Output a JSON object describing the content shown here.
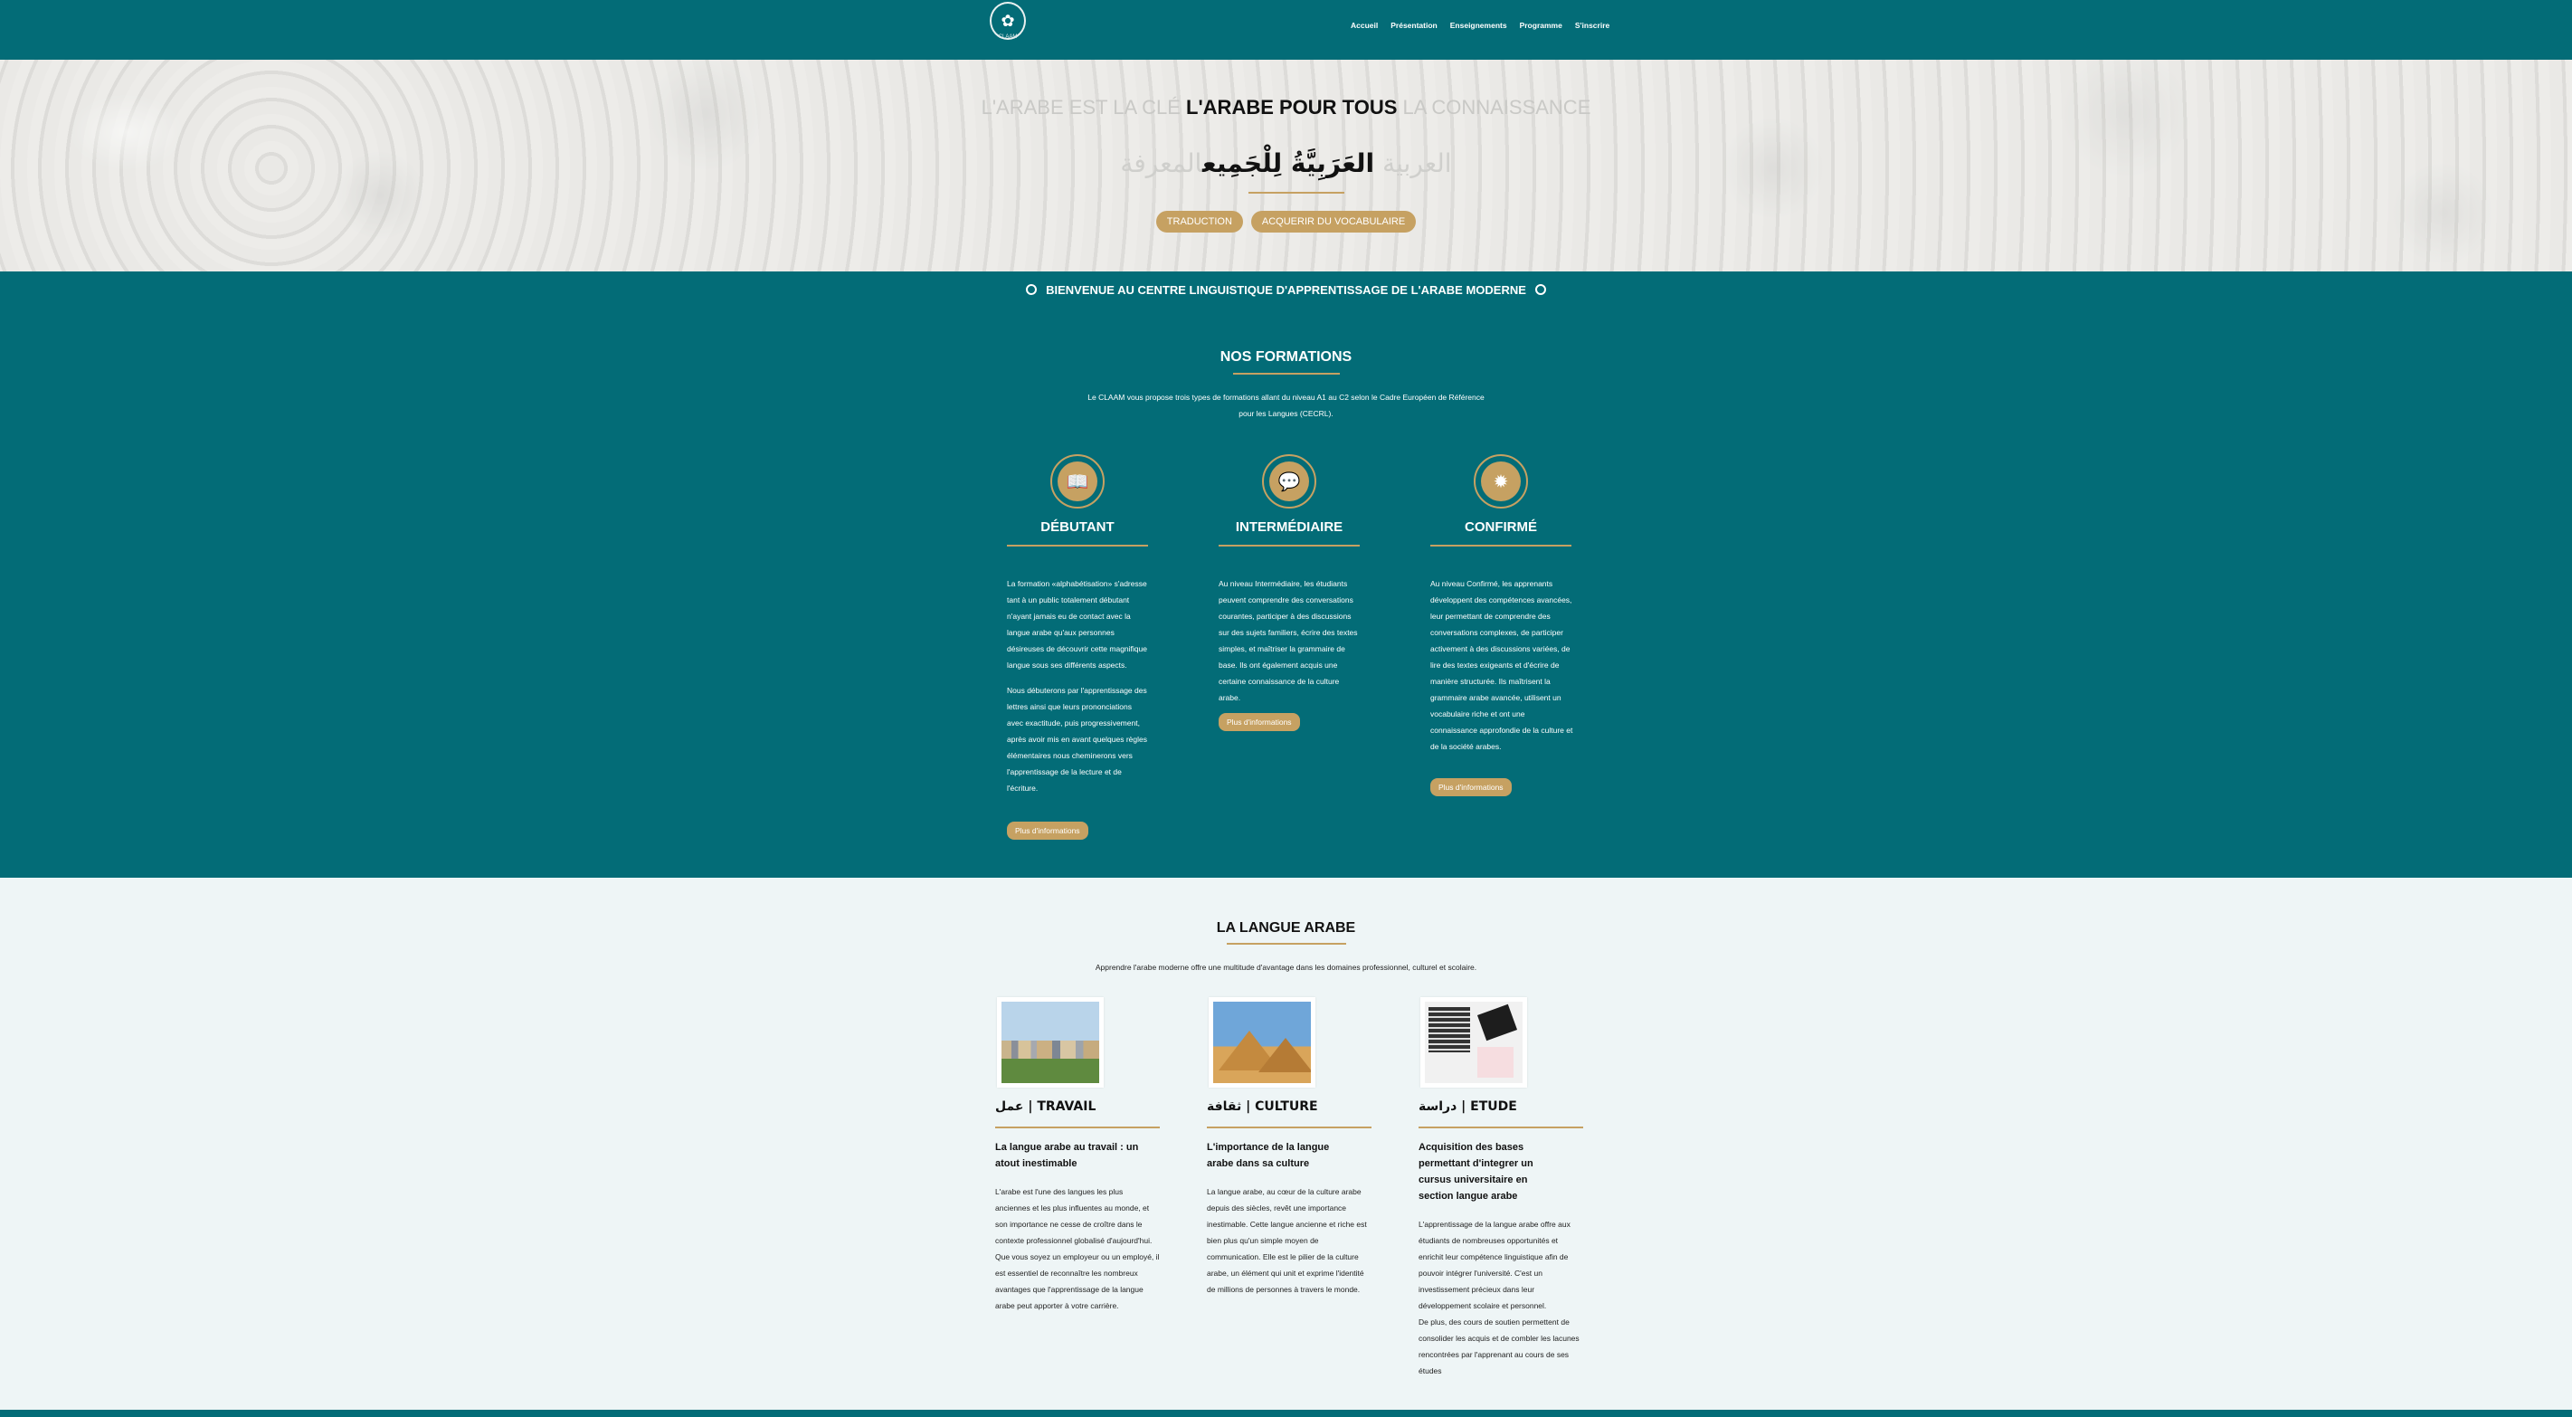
{
  "header": {
    "logo_glyph": "✿",
    "logo_text": "CLAAM",
    "nav": [
      "Accueil",
      "Présentation",
      "Enseignements",
      "Programme",
      "S'inscrire"
    ]
  },
  "hero": {
    "line1_left": "L'ARABE EST LA CLÉ",
    "line1_main": "L'ARABE POUR TOUS",
    "line1_right": "LA CONNAISSANCE",
    "line2_faded_left": "العربية",
    "line2_main": "العَرَبِيَّةُ لِلْجَمِيع",
    "line2_faded_right": "المعرفة",
    "buttons": [
      "TRADUCTION",
      "ACQUERIR DU VOCABULAIRE"
    ]
  },
  "welcome": "BIENVENUE AU CENTRE LINGUISTIQUE D'APPRENTISSAGE DE L'ARABE MODERNE",
  "formations": {
    "title": "NOS FORMATIONS",
    "intro_line1": "Le CLAAM vous propose trois types de formations allant du niveau A1 au C2 selon le Cadre Européen de Référence",
    "intro_line2": "pour les Langues (CECRL).",
    "columns": [
      {
        "icon": "book-icon",
        "glyph": "📖",
        "title": "DÉBUTANT",
        "paragraphs": [
          "La formation «alphabétisation» s'adresse tant à un public totalement débutant n'ayant jamais eu de contact avec la langue arabe qu'aux personnes désireuses de découvrir cette magnifique langue sous ses différents aspects.",
          "Nous débuterons par l'apprentissage des lettres ainsi que leurs prononciations avec exactitude, puis progressivement, après avoir mis en avant quelques règles élémentaires nous cheminerons vers l'apprentissage de la lecture et de l'écriture."
        ],
        "more": "Plus d'informations"
      },
      {
        "icon": "chat-bubbles-icon",
        "glyph": "💬",
        "title": "INTERMÉDIAIRE",
        "paragraphs": [
          "Au niveau Intermédiaire, les étudiants peuvent comprendre des conversations courantes, participer à des discussions sur des sujets familiers, écrire des textes simples, et maîtriser la grammaire de base. Ils ont également acquis une certaine connaissance de la culture arabe."
        ],
        "more": "Plus d'informations"
      },
      {
        "icon": "star-seal-icon",
        "glyph": "✹",
        "title": "CONFIRMÉ",
        "paragraphs": [
          "Au niveau Confirmé, les apprenants développent des compétences avancées, leur permettant de comprendre des conversations complexes, de participer activement à des discussions variées, de lire des textes exigeants et d'écrire de manière structurée. Ils maîtrisent la grammaire arabe avancée, utilisent un vocabulaire riche et ont une connaissance approfondie de la culture et de la société arabes."
        ],
        "more": "Plus d'informations"
      }
    ]
  },
  "langue": {
    "title": "LA LANGUE ARABE",
    "intro": "Apprendre l'arabe moderne offre une multitude d'avantage dans les domaines professionnel, culturel et scolaire.",
    "columns": [
      {
        "heading": "عمل | TRAVAIL",
        "sub": "La langue arabe au travail : un atout inestimable",
        "text": "L'arabe est l'une des langues les plus anciennes et les plus influentes au monde, et son importance ne cesse de croître dans le contexte professionnel globalisé d'aujourd'hui. Que vous soyez un employeur ou un employé, il est essentiel de reconnaître les nombreux avantages que l'apprentissage de la langue arabe peut apporter à votre carrière."
      },
      {
        "heading": "ثقافة | CULTURE",
        "sub": "L'importance de la langue arabe dans sa culture",
        "text": "La langue arabe, au cœur de la culture arabe depuis des siècles, revêt une importance inestimable. Cette langue ancienne et riche est bien plus qu'un simple moyen de communication. Elle est le pilier de la culture arabe, un élément qui unit et exprime l'identité de millions de personnes à travers le monde."
      },
      {
        "heading": "دراسة | ETUDE",
        "sub": "Acquisition des bases permettant d'integrer un cursus universitaire en section langue arabe",
        "text": "L'apprentissage de la langue arabe offre aux étudiants de nombreuses opportunités et enrichit leur compétence linguistique afin de pouvoir intégrer l'université. C'est un investissement précieux dans leur développement scolaire et personnel.",
        "text2": "De plus, des cours de soutien permettent de consolider les acquis et de combler les lacunes rencontrées par l'apprenant au cours de ses études"
      }
    ]
  },
  "colors": {
    "teal": "#036c77",
    "gold": "#c6a162",
    "light_bg": "#eef5f6"
  }
}
